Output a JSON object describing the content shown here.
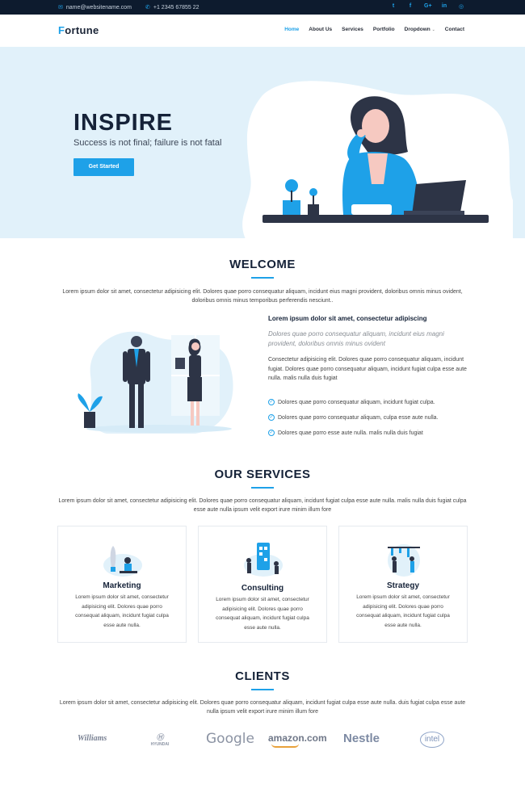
{
  "topbar": {
    "email": "name@websitename.com",
    "phone": "+1 2345 67855 22",
    "social_icons": [
      "twitter-icon",
      "facebook-icon",
      "google-plus-icon",
      "linkedin-icon",
      "instagram-icon"
    ]
  },
  "header": {
    "logo_first": "F",
    "logo_rest": "ortune",
    "nav": [
      "Home",
      "About Us",
      "Services",
      "Portfolio",
      "Dropdown",
      "Contact"
    ]
  },
  "hero": {
    "title": "INSPIRE",
    "subtitle": "Success is not final; failure is not fatal",
    "button": "Get Started"
  },
  "welcome": {
    "title": "WELCOME",
    "text": "Lorem ipsum dolor sit amet, consectetur adipisicing elit. Dolores quae porro consequatur aliquam, incidunt eius magni provident, doloribus omnis minus ovident, doloribus omnis minus temporibus perferendis nesciunt..",
    "heading": "Lorem ipsum dolor sit amet, consectetur adipiscing",
    "italic": "Dolores quae porro consequatur aliquam, incidunt eius magni provident, doloribus omnis minus ovident",
    "paragraph": "Consectetur adipisicing elit. Dolores quae porro consequatur aliquam, incidunt fugiat. Dolores quae porro consequatur aliquam, incidunt fugiat culpa esse aute nulla. malis nulla duis fugiat",
    "checks": [
      "Dolores quae porro consequatur aliquam, incidunt fugiat culpa.",
      "Dolores quae porro consequatur aliquam, culpa esse aute nulla.",
      "Dolores quae porro esse aute nulla. malis nulla duis fugiat"
    ]
  },
  "services": {
    "title": "OUR SERVICES",
    "text": "Lorem ipsum dolor sit amet, consectetur adipisicing elit. Dolores quae porro consequatur aliquam, incidunt fugiat culpa esse aute nulla. malis nulla duis fugiat culpa esse aute nulla ipsum velit export irure minim illum fore",
    "cards": [
      {
        "title": "Marketing",
        "text": "Lorem ipsum dolor sit amet, consectetur adipisicing elit. Dolores quae porro consequat aliquam, incidunt fugiat culpa esse aute nulla.",
        "icon": "rocket-icon"
      },
      {
        "title": "Consulting",
        "text": "Lorem ipsum dolor sit amet, consectetur adipisicing elit. Dolores quae porro consequat aliquam, incidunt fugiat culpa esse aute nulla.",
        "icon": "phone-app-icon"
      },
      {
        "title": "Strategy",
        "text": "Lorem ipsum dolor sit amet, consectetur adipisicing elit. Dolores quae porro consequat aliquam, incidunt fugiat culpa esse aute nulla.",
        "icon": "team-board-icon"
      }
    ]
  },
  "clients": {
    "title": "CLIENTS",
    "text": "Lorem ipsum dolor sit amet, consectetur adipisicing elit. Dolores quae porro consequatur aliquam, incidunt fugiat culpa esse aute nulla. duis fugiat culpa esse aute nulla ipsum velit export irure minim illum fore",
    "logos": [
      "Williams",
      "HYUNDAI",
      "Google",
      "amazon.com",
      "Nestle",
      "intel"
    ]
  },
  "colors": {
    "accent": "#1ea1e8",
    "dark": "#152238",
    "topbar_bg": "#0d1b2e",
    "hero_bg": "#e1f1fa"
  }
}
